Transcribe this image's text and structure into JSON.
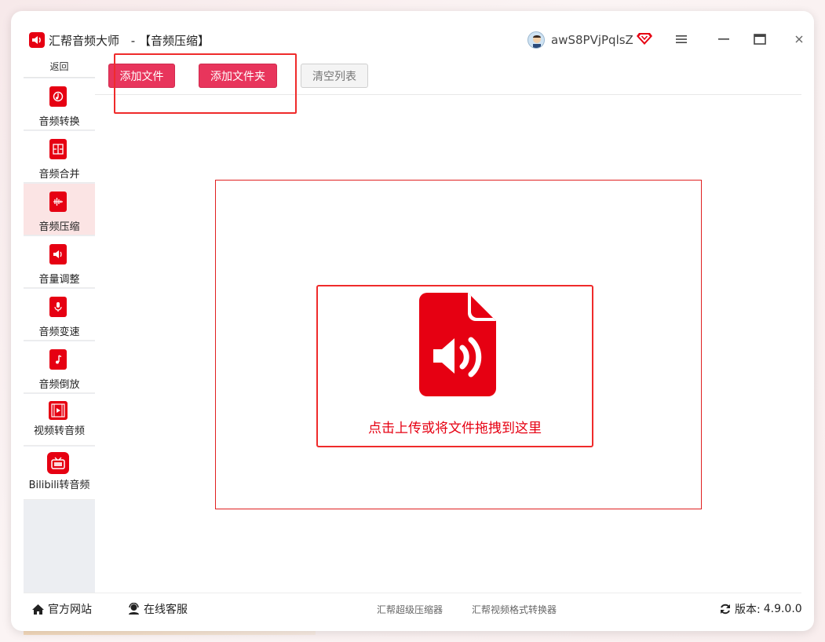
{
  "window": {
    "app_name": "汇帮音频大师",
    "separator": "-",
    "current_page": "【音频压缩】",
    "username": "awS8PVjPqlsZ"
  },
  "sidebar": {
    "back_label": "返回",
    "items": [
      {
        "label": "音频转换",
        "icon": "audio-convert-icon",
        "active": false
      },
      {
        "label": "音频合并",
        "icon": "audio-merge-icon",
        "active": false
      },
      {
        "label": "音频压缩",
        "icon": "audio-compress-icon",
        "active": true
      },
      {
        "label": "音量调整",
        "icon": "volume-adjust-icon",
        "active": false
      },
      {
        "label": "音频变速",
        "icon": "audio-speed-icon",
        "active": false
      },
      {
        "label": "音频倒放",
        "icon": "audio-reverse-icon",
        "active": false
      },
      {
        "label": "视频转音频",
        "icon": "video-to-audio-icon",
        "active": false
      },
      {
        "label": "Bilibili转音频",
        "icon": "bilibili-tv-icon",
        "active": false
      }
    ]
  },
  "toolbar": {
    "add_file_label": "添加文件",
    "add_folder_label": "添加文件夹",
    "clear_list_label": "清空列表"
  },
  "dropzone": {
    "text": "点击上传或将文件拖拽到这里",
    "icon": "audio-file-icon"
  },
  "footer": {
    "website_label": "官方网站",
    "support_label": "在线客服",
    "link1": "汇帮超级压缩器",
    "link2": "汇帮视频格式转换器",
    "version_label": "版本:",
    "version_value": "4.9.0.0"
  },
  "colors": {
    "brand_red": "#e60012",
    "button_pink": "#e8355c",
    "annotation_red": "#ef2b2b",
    "active_item_bg": "#fbe4e4"
  }
}
